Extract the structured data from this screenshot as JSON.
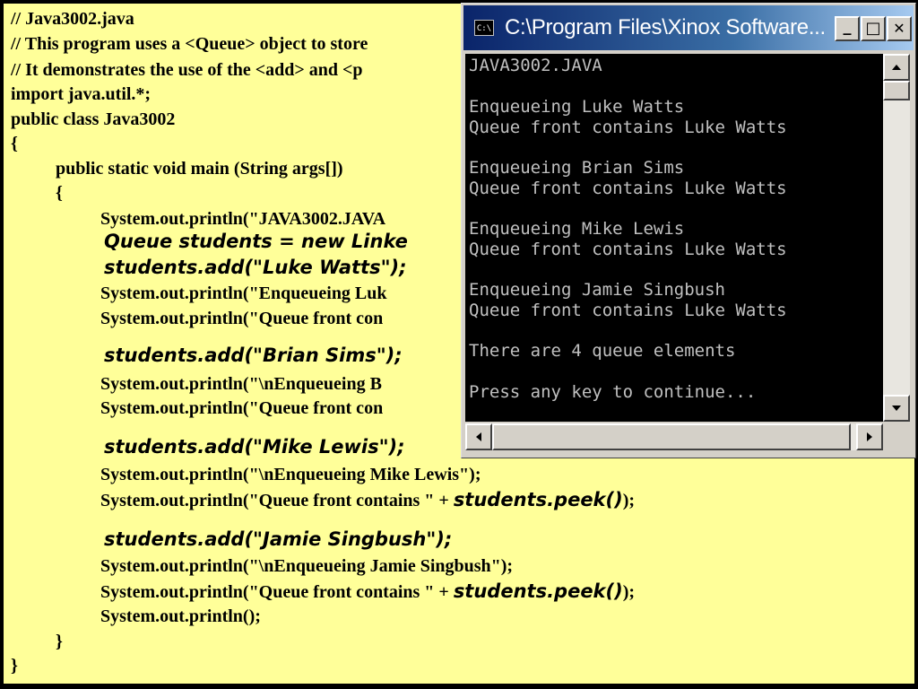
{
  "code_lines": [
    "// Java3002.java",
    "// This program uses a <Queue> object to store",
    "// It demonstrates the use of the <add> and <p",
    "import java.util.*;",
    "public class Java3002",
    "{",
    "public static void main (String args[])",
    "{",
    "System.out.println(\"JAVA3002.JAVA",
    "Queue students = new Linke",
    "students.add(\"Luke Watts\");",
    "System.out.println(\"Enqueueing Luk",
    "System.out.println(\"Queue front con",
    "students.add(\"Brian Sims\");",
    "System.out.println(\"\\nEnqueueing B",
    "System.out.println(\"Queue front con",
    "students.add(\"Mike Lewis\");",
    "System.out.println(\"\\nEnqueueing Mike Lewis\");",
    "System.out.println(\"Queue front contains \" + ",
    "students.peek()",
    ");",
    "students.add(\"Jamie Singbush\");",
    "System.out.println(\"\\nEnqueueing Jamie Singbush\");",
    "System.out.println(\"Queue front contains \" + ",
    "students.peek()",
    ");",
    "System.out.println();",
    "}",
    "}"
  ],
  "console_window": {
    "title": "C:\\Program Files\\Xinox Software...",
    "icon_label": "C:\\",
    "minimize": "_",
    "maximize": "□",
    "close": "✕",
    "output": [
      "JAVA3002.JAVA",
      "Enqueueing Luke Watts",
      "Queue front contains Luke Watts",
      "Enqueueing Brian Sims",
      "Queue front contains Luke Watts",
      "Enqueueing Mike Lewis",
      "Queue front contains Luke Watts",
      "Enqueueing Jamie Singbush",
      "Queue front contains Luke Watts",
      "There are 4 queue elements",
      "Press any key to continue..."
    ]
  },
  "colors": {
    "slide_background": "#ffff99",
    "console_background": "#000000",
    "console_text": "#c0c0c0",
    "titlebar_start": "#0a246a",
    "titlebar_end": "#a6caf0"
  }
}
